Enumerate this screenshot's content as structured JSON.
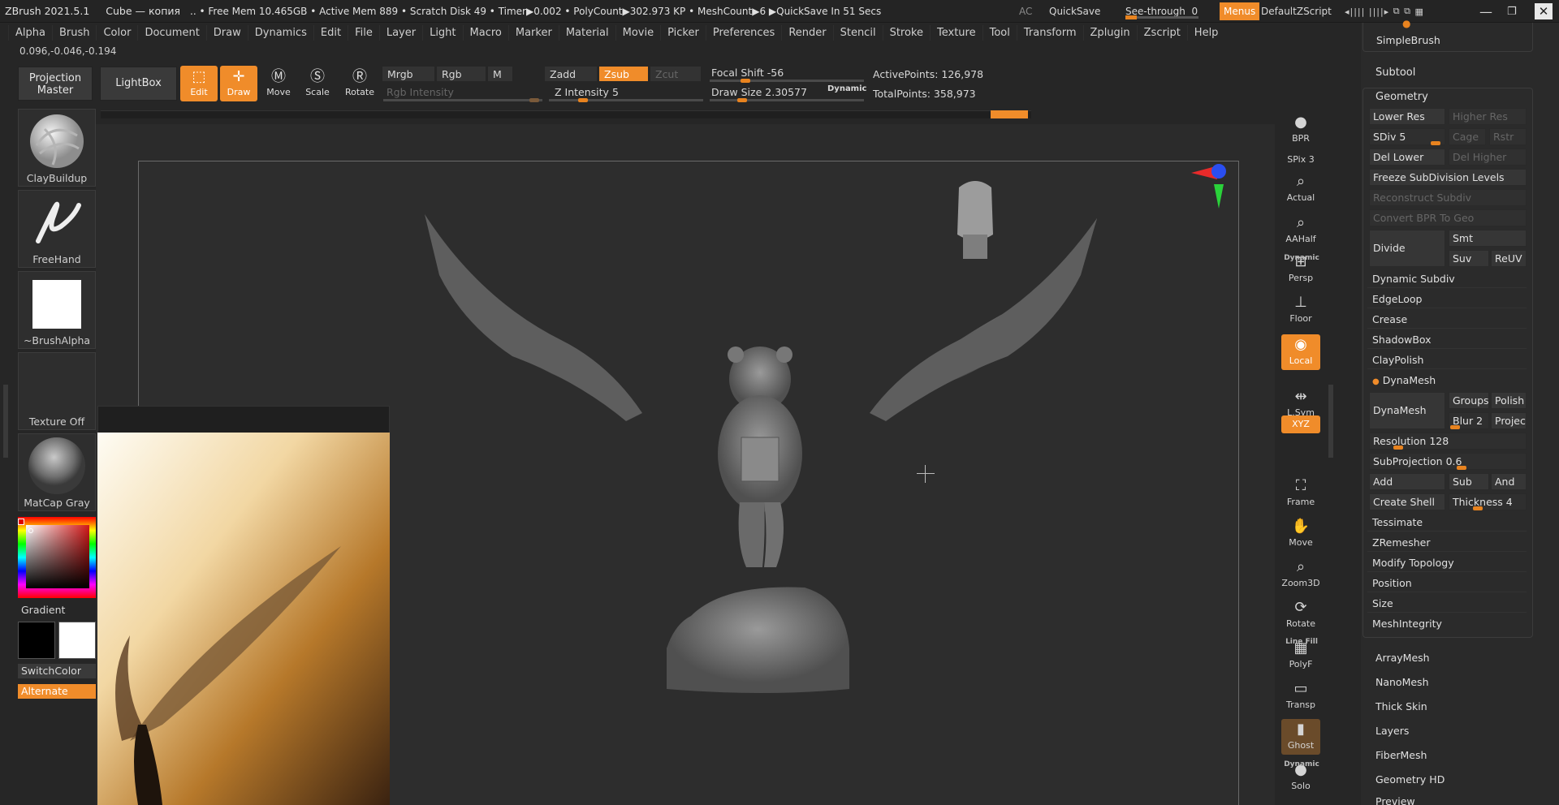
{
  "titlebar": {
    "title": "ZBrush 2021.5.1",
    "doc": "Cube — копия",
    "stats": ".. • Free Mem 10.465GB • Active Mem 889 • Scratch Disk 49 •  Timer▶0.002 • PolyCount▶302.973 KP  • MeshCount▶6  ▶QuickSave In 51 Secs",
    "ac": "AC",
    "quicksave": "QuickSave",
    "see_through_label": "See-through",
    "see_through_value": "0",
    "menus": "Menus",
    "default_zscript": "DefaultZScript"
  },
  "menubar": [
    "Alpha",
    "Brush",
    "Color",
    "Document",
    "Draw",
    "Dynamics",
    "Edit",
    "File",
    "Layer",
    "Light",
    "Macro",
    "Marker",
    "Material",
    "Movie",
    "Picker",
    "Preferences",
    "Render",
    "Stencil",
    "Stroke",
    "Texture",
    "Tool",
    "Transform",
    "Zplugin",
    "Zscript",
    "Help"
  ],
  "coords": "0.096,-0.046,-0.194",
  "toolbar": {
    "projection_master": "Projection Master",
    "lightbox": "LightBox",
    "edit": "Edit",
    "draw": "Draw",
    "move": "Move",
    "scale": "Scale",
    "rotate": "Rotate",
    "mrgb": "Mrgb",
    "rgb": "Rgb",
    "m": "M",
    "rgb_intensity": "Rgb Intensity",
    "zadd": "Zadd",
    "zsub": "Zsub",
    "zcut": "Zcut",
    "z_intensity_label": "Z Intensity",
    "z_intensity_value": "5",
    "focal_shift_label": "Focal Shift",
    "focal_shift_value": "-56",
    "draw_size_label": "Draw Size",
    "draw_size_value": "2.30577",
    "dynamic": "Dynamic",
    "active_points": "ActivePoints: 126,978",
    "total_points": "TotalPoints: 358,973"
  },
  "left_shelf": {
    "brush": "ClayBuildup",
    "stroke": "FreeHand",
    "alpha": "~BrushAlpha",
    "texture": "Texture Off",
    "material": "MatCap Gray",
    "gradient": "Gradient",
    "switch_color": "SwitchColor",
    "alternate": "Alternate"
  },
  "right_shelf": [
    {
      "name": "bpr",
      "label": "BPR"
    },
    {
      "name": "spix",
      "label": "SPix 3"
    },
    {
      "name": "actual",
      "label": "Actual"
    },
    {
      "name": "aahalf",
      "label": "AAHalf"
    },
    {
      "name": "persp",
      "label": "Persp"
    },
    {
      "name": "floor",
      "label": "Floor"
    },
    {
      "name": "local",
      "label": "Local"
    },
    {
      "name": "lsym",
      "label": "L.Sym"
    },
    {
      "name": "xyz",
      "label": "XYZ"
    },
    {
      "name": "frame",
      "label": "Frame"
    },
    {
      "name": "move",
      "label": "Move"
    },
    {
      "name": "zoom3d",
      "label": "Zoom3D"
    },
    {
      "name": "rotate",
      "label": "Rotate"
    },
    {
      "name": "polyf",
      "label": "PolyF"
    },
    {
      "name": "transp",
      "label": "Transp"
    },
    {
      "name": "ghost",
      "label": "Ghost"
    },
    {
      "name": "solo",
      "label": "Solo"
    }
  ],
  "right_shelf_small": {
    "dynamic1": "Dynamic",
    "line_fill": "Line Fill",
    "dynamic2": "Dynamic"
  },
  "palette": {
    "simplebrush": "SimpleBrush",
    "subtool": "Subtool",
    "geometry": "Geometry",
    "lower_res": "Lower Res",
    "higher_res": "Higher Res",
    "sdiv_label": "SDiv",
    "sdiv_value": "5",
    "cage": "Cage",
    "rstr": "Rstr",
    "del_lower": "Del Lower",
    "del_higher": "Del Higher",
    "freeze": "Freeze SubDivision Levels",
    "reconstruct": "Reconstruct Subdiv",
    "convert_bpr": "Convert BPR To Geo",
    "divide": "Divide",
    "smt": "Smt",
    "suv": "Suv",
    "reuv": "ReUV",
    "dynamic_subdiv": "Dynamic Subdiv",
    "edgeloop": "EdgeLoop",
    "crease": "Crease",
    "shadowbox": "ShadowBox",
    "claypolish": "ClayPolish",
    "dynamesh_header": "DynaMesh",
    "dynamesh_btn": "DynaMesh",
    "groups": "Groups",
    "polish": "Polish",
    "blur_label": "Blur",
    "blur_value": "2",
    "project": "Project",
    "resolution_label": "Resolution",
    "resolution_value": "128",
    "subprojection_label": "SubProjection",
    "subprojection_value": "0.6",
    "add": "Add",
    "sub": "Sub",
    "and": "And",
    "create_shell": "Create Shell",
    "thickness_label": "Thickness",
    "thickness_value": "4",
    "tessimate": "Tessimate",
    "zremesher": "ZRemesher",
    "modify_topology": "Modify Topology",
    "position": "Position",
    "size": "Size",
    "meshintegrity": "MeshIntegrity",
    "arraymesh": "ArrayMesh",
    "nanomesh": "NanoMesh",
    "thickskin": "Thick Skin",
    "layers": "Layers",
    "fibermesh": "FiberMesh",
    "geometry_hd": "Geometry HD",
    "preview": "Preview"
  },
  "colors": {
    "accent": "#f08c2a",
    "bg": "#262626",
    "panel": "#2a2a2a"
  }
}
